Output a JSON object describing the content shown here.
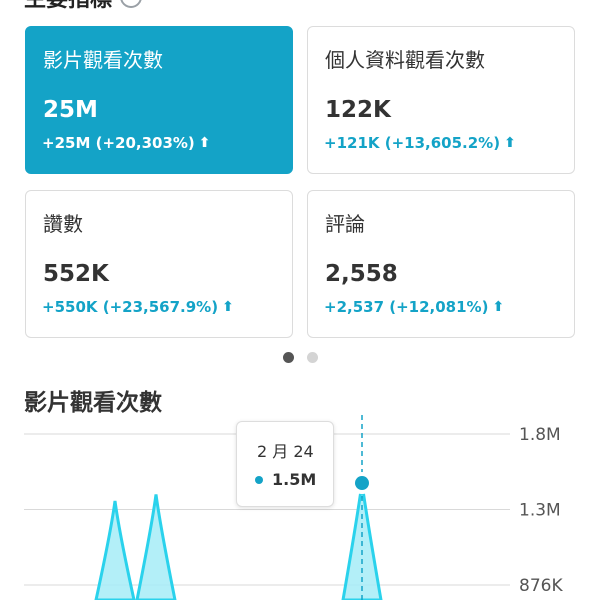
{
  "section": {
    "title": "主要指標",
    "help_icon": "question-circle-icon"
  },
  "metrics": [
    {
      "title": "影片觀看次數",
      "value": "25M",
      "change": "+25M (+20,303%)",
      "arrow": "arrow-up-icon"
    },
    {
      "title": "個人資料觀看次數",
      "value": "122K",
      "change": "+121K (+13,605.2%)",
      "arrow": "arrow-up-icon"
    },
    {
      "title": "讚數",
      "value": "552K",
      "change": "+550K (+23,567.9%)",
      "arrow": "arrow-up-icon"
    },
    {
      "title": "評論",
      "value": "2,558",
      "change": "+2,537 (+12,081%)",
      "arrow": "arrow-up-icon"
    }
  ],
  "pagination": {
    "pages": 2,
    "current": 1
  },
  "chart": {
    "title": "影片觀看次數"
  },
  "tooltip": {
    "date": "2 月 24",
    "value": "1.5M"
  },
  "colors": {
    "accent": "#14a3c7",
    "area_fill": "#a6ecf7",
    "line": "#2ad2ec"
  },
  "chart_data": {
    "type": "area",
    "title": "影片觀看次數",
    "y_ticks": [
      "1.8M",
      "1.3M",
      "876K"
    ],
    "ylim": [
      876000,
      1800000
    ],
    "visible_peaks": [
      {
        "value": 1390000
      },
      {
        "value": 1430000
      },
      {
        "label": "2 月 24",
        "value": 1500000,
        "highlighted": true
      }
    ],
    "grid": true
  }
}
